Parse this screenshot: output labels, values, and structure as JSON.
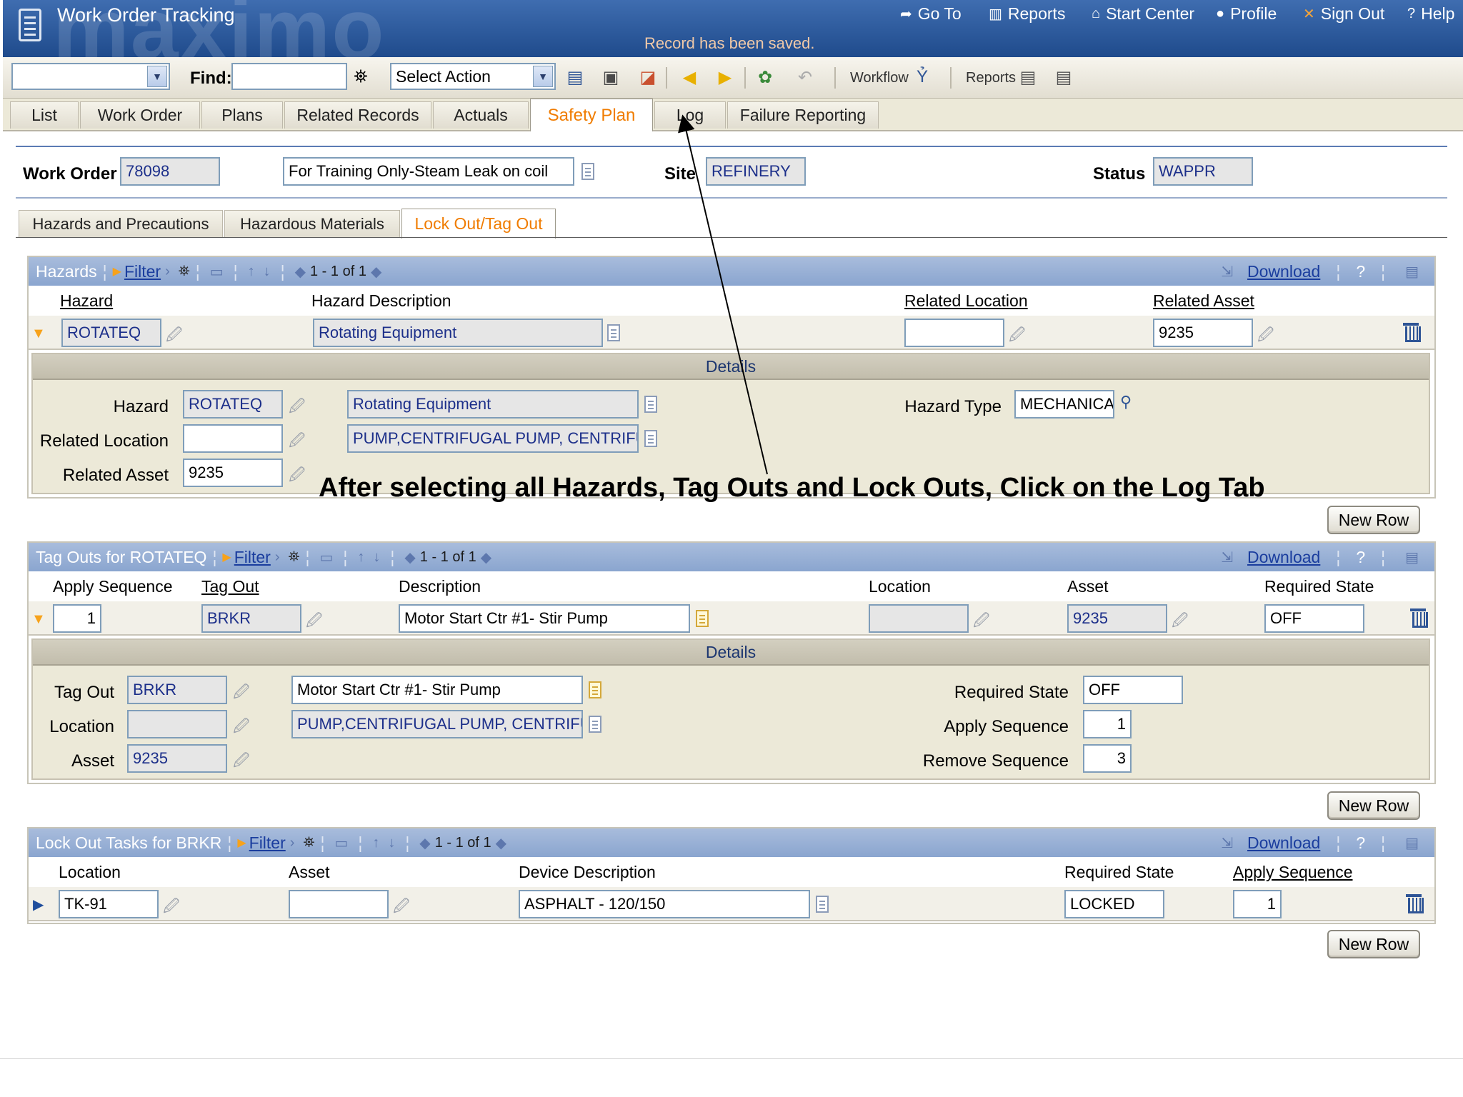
{
  "header": {
    "app_title": "Work Order Tracking",
    "brand_watermark": "maximo",
    "saved_message": "Record has been saved.",
    "links": [
      {
        "label": "Go To",
        "icon": "arrow-icon"
      },
      {
        "label": "Reports",
        "icon": "bar-chart-icon"
      },
      {
        "label": "Start Center",
        "icon": "home-icon"
      },
      {
        "label": "Profile",
        "icon": "person-icon"
      },
      {
        "label": "Sign Out",
        "icon": "x-icon"
      },
      {
        "label": "Help",
        "icon": "question-icon"
      }
    ]
  },
  "toolbar": {
    "query_value": "",
    "find_label": "Find:",
    "find_value": "",
    "select_action": "Select Action",
    "workflow_label": "Workflow",
    "reports_label": "Reports"
  },
  "main_tabs": [
    "List",
    "Work Order",
    "Plans",
    "Related Records",
    "Actuals",
    "Safety Plan",
    "Log",
    "Failure Reporting"
  ],
  "active_main_tab": "Safety Plan",
  "work_order": {
    "wo_label": "Work Order",
    "wo_number": "78098",
    "description": "For Training Only-Steam Leak on coil",
    "site_label": "Site",
    "site": "REFINERY",
    "status_label": "Status",
    "status": "WAPPR"
  },
  "sub_tabs": [
    "Hazards and Precautions",
    "Hazardous Materials",
    "Lock Out/Tag Out"
  ],
  "active_sub_tab": "Lock Out/Tag Out",
  "table_common": {
    "filter": "Filter",
    "download": "Download",
    "help": "?",
    "new_row": "New Row",
    "details": "Details"
  },
  "hazards": {
    "title": "Hazards",
    "page_info": "1 - 1 of 1",
    "columns": [
      "Hazard",
      "Hazard Description",
      "Related Location",
      "Related Asset"
    ],
    "row": {
      "hazard": "ROTATEQ",
      "description": "Rotating Equipment",
      "location": "",
      "asset": "9235"
    },
    "details": {
      "hazard_label": "Hazard",
      "hazard": "ROTATEQ",
      "hazard_desc": "Rotating Equipment",
      "location_label": "Related Location",
      "location": "",
      "location_desc": "PUMP,CENTRIFUGAL PUMP, CENTRIFUGAL",
      "asset_label": "Related Asset",
      "asset": "9235",
      "type_label": "Hazard Type",
      "type": "MECHANICAL"
    }
  },
  "tagouts": {
    "title": "Tag Outs for ROTATEQ",
    "page_info": "1 - 1 of 1",
    "columns": [
      "Apply Sequence",
      "Tag Out",
      "Description",
      "Location",
      "Asset",
      "Required State"
    ],
    "row": {
      "apply_seq": "1",
      "tag_out": "BRKR",
      "description": "Motor Start Ctr #1- Stir Pump",
      "location": "",
      "asset": "9235",
      "required_state": "OFF"
    },
    "details": {
      "tag_label": "Tag Out",
      "tag": "BRKR",
      "tag_desc": "Motor Start Ctr #1- Stir Pump",
      "location_label": "Location",
      "location": "",
      "location_desc": "PUMP,CENTRIFUGAL PUMP, CENTRIFUGAL",
      "asset_label": "Asset",
      "asset": "9235",
      "req_label": "Required State",
      "req": "OFF",
      "apply_label": "Apply Sequence",
      "apply": "1",
      "remove_label": "Remove Sequence",
      "remove": "3"
    }
  },
  "lockouts": {
    "title": "Lock Out Tasks for BRKR",
    "page_info": "1 - 1 of 1",
    "columns": [
      "Location",
      "Asset",
      "Device Description",
      "Required State",
      "Apply Sequence"
    ],
    "row": {
      "location": "TK-91",
      "asset": "",
      "description": "ASPHALT - 120/150",
      "required_state": "LOCKED",
      "apply_seq": "1"
    }
  },
  "annotation": "After selecting all Hazards, Tag Outs and Lock Outs, Click on the Log Tab",
  "colors": {
    "header_blue": "#1f4b8c",
    "section_bar": "#8aa5cf",
    "active_tab": "#f07c00",
    "field_text": "#1c2f8a"
  }
}
